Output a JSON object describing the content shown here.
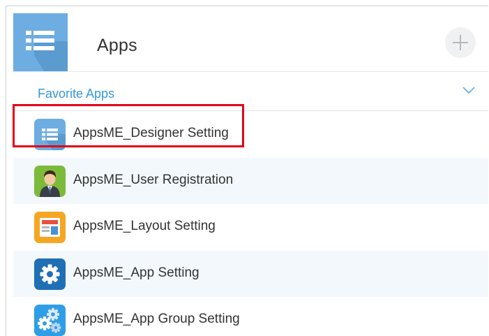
{
  "header": {
    "title": "Apps",
    "icon": "app-list-icon",
    "add_icon": "plus-icon"
  },
  "favorites": {
    "label": "Favorite Apps",
    "toggle_icon": "chevron-down-icon"
  },
  "apps": [
    {
      "name": "AppsME_Designer Setting",
      "icon": "list-icon",
      "highlighted": true
    },
    {
      "name": "AppsME_User Registration",
      "icon": "user-avatar-icon"
    },
    {
      "name": "AppsME_Layout Setting",
      "icon": "layout-icon"
    },
    {
      "name": "AppsME_App Setting",
      "icon": "gear-icon"
    },
    {
      "name": "AppsME_App Group Setting",
      "icon": "gears-icon"
    }
  ],
  "colors": {
    "header_icon_bg": "#6dade1",
    "favorite_label": "#3498db",
    "alt_row_bg": "#f3f8fc",
    "highlight": "#e2001a"
  }
}
